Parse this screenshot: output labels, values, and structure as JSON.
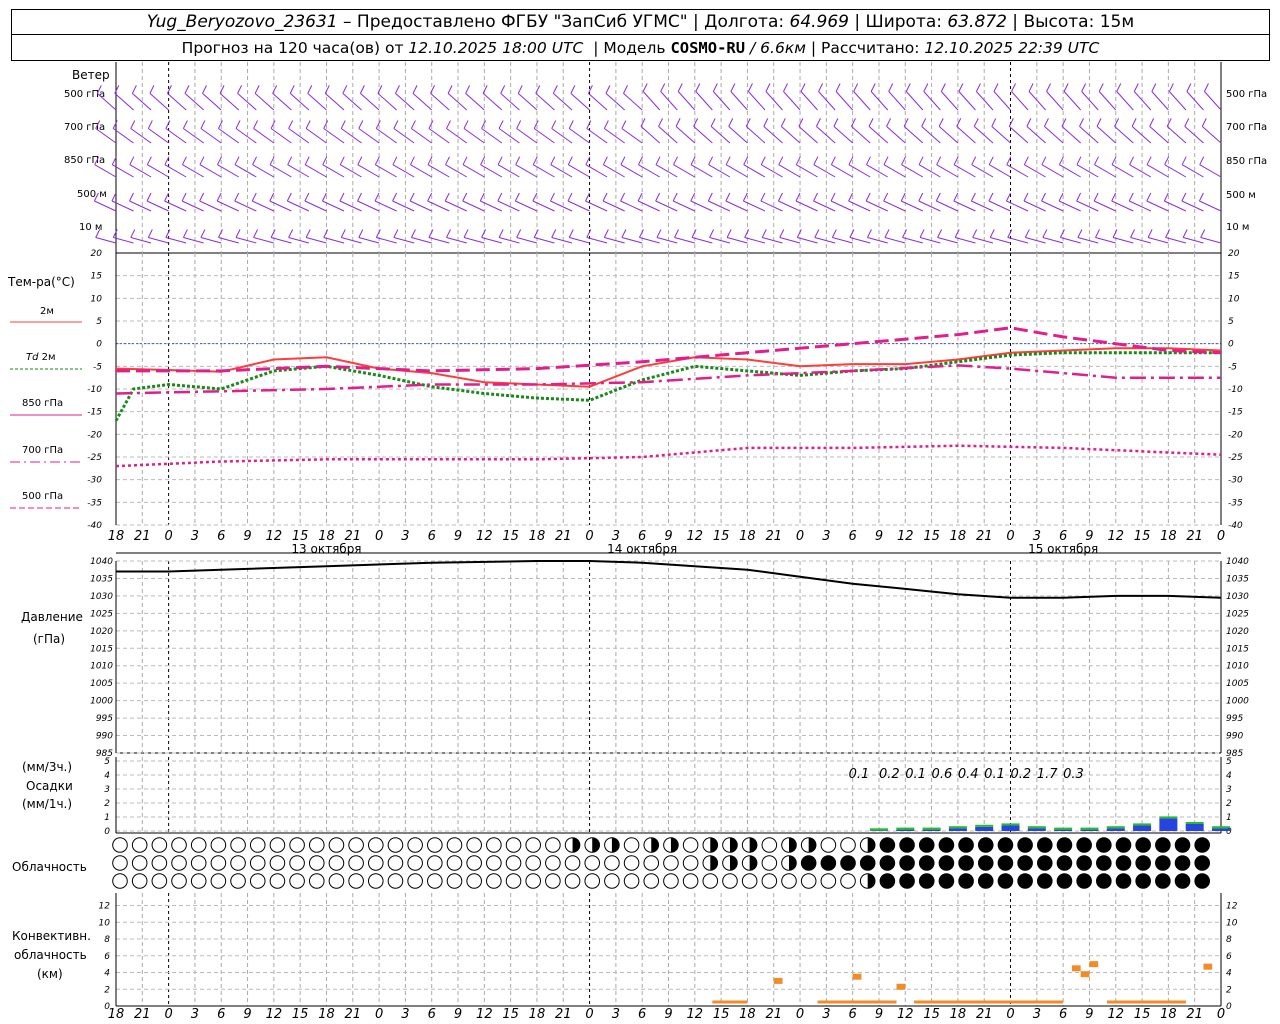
{
  "header": {
    "station": "Yug_Beryozovo_23631",
    "provider": "– Предоставлено ФГБУ \"ЗапСиб УГМС\"",
    "lon_label": "Долгота:",
    "lon": "64.969",
    "lat_label": "Широта:",
    "lat": "63.872",
    "alt_label": "Высота:",
    "alt": "15м",
    "fc_prefix": "Прогноз на 120 часа(ов) от",
    "fc_time": "12.10.2025 18:00 UTC",
    "model_prefix": "| Модель",
    "model": "COSMO-RU",
    "model_res": "/ 6.6км",
    "calc_prefix": "| Рассчитано:",
    "calc_time": "12.10.2025 22:39 UTC"
  },
  "labels": {
    "wind": "Ветер",
    "levels": [
      "500 гПа",
      "700 гПа",
      "850 гПа",
      "500 м",
      "10 м"
    ],
    "temp": "Тем-ра(°С)",
    "t2m": "2м",
    "td": "Td",
    "td2m": "2м",
    "t850": "850 гПа",
    "t700": "700 гПа",
    "t500": "500 гПа",
    "pres1": "Давление",
    "pres2": "(гПа)",
    "precip1": "(мм/3ч.)",
    "precip2": "Осадки",
    "precip3": "(мм/1ч.)",
    "cloud": "Облачность",
    "conv1": "Конвективн.",
    "conv2": "облачность",
    "conv3": "(км)"
  },
  "dates": [
    "13 октября",
    "14 октября",
    "15 октября"
  ],
  "colors": {
    "t2m": "#ff3c3c",
    "td": "#178a17",
    "levels": "#e01e8c",
    "wind": "#8a2be2",
    "pressure": "#000000",
    "conv": "#f28c28",
    "rain_green": "#22c022",
    "rain_blue": "#2844e0",
    "zero": "#3a5bd9"
  },
  "chart_data": [
    {
      "type": "line",
      "title": "Ветер",
      "x_hours": [
        18,
        21,
        0,
        3,
        6,
        9,
        12,
        15,
        18,
        21,
        0,
        3,
        6,
        9,
        12,
        15,
        18,
        21,
        0,
        3,
        6,
        9,
        12,
        15,
        18,
        21,
        0,
        3,
        6,
        9,
        12,
        15,
        18,
        21,
        0,
        3,
        6,
        9,
        12,
        15,
        18,
        21,
        0
      ],
      "series": [
        {
          "name": "500 гПа",
          "dir": 300
        },
        {
          "name": "700 гПа",
          "dir": 290
        },
        {
          "name": "850 гПа",
          "dir": 280
        },
        {
          "name": "500 м",
          "dir": 270
        },
        {
          "name": "10 м",
          "dir": 250
        }
      ]
    },
    {
      "type": "line",
      "title": "Тем-ра(°С)",
      "ylim": [
        -40,
        20
      ],
      "x_range_hours": [
        0,
        126
      ],
      "series": [
        {
          "name": "2м",
          "x": [
            0,
            6,
            12,
            18,
            24,
            30,
            36,
            42,
            48,
            54,
            60,
            66,
            72,
            78,
            84,
            90,
            96,
            102,
            108,
            114,
            120,
            126
          ],
          "values": [
            -5.5,
            -5.8,
            -6.2,
            -3.5,
            -3,
            -5.5,
            -6.5,
            -8.5,
            -9,
            -9.5,
            -5,
            -3,
            -3.5,
            -5,
            -4.5,
            -4.5,
            -3.5,
            -2,
            -1.5,
            -1,
            -1,
            -1.5
          ]
        },
        {
          "name": "Td 2м",
          "x": [
            0,
            2,
            6,
            12,
            18,
            24,
            30,
            36,
            42,
            48,
            54,
            60,
            66,
            72,
            78,
            84,
            90,
            96,
            102,
            108,
            114,
            120,
            126
          ],
          "values": [
            -17,
            -10,
            -9,
            -10,
            -6,
            -5,
            -7,
            -9.5,
            -11,
            -12,
            -12.5,
            -8,
            -5,
            -6,
            -7,
            -6,
            -5.5,
            -4,
            -2.5,
            -2,
            -2,
            -2,
            -2
          ]
        },
        {
          "name": "850 гПа",
          "x": [
            0,
            12,
            24,
            36,
            48,
            60,
            72,
            84,
            96,
            102,
            108,
            114,
            120,
            126
          ],
          "values": [
            -6,
            -6,
            -5,
            -6,
            -5.5,
            -4,
            -2,
            0,
            2,
            3.5,
            1.5,
            0,
            -1.5,
            -2
          ]
        },
        {
          "name": "700 гПа",
          "x": [
            0,
            12,
            24,
            36,
            48,
            60,
            72,
            84,
            96,
            102,
            108,
            114,
            120,
            126
          ],
          "values": [
            -11,
            -10.5,
            -10,
            -9,
            -9,
            -8.5,
            -7,
            -6,
            -4.8,
            -5.5,
            -6.5,
            -7.5,
            -7.5,
            -7.5
          ]
        },
        {
          "name": "500 гПа",
          "x": [
            0,
            12,
            24,
            36,
            48,
            60,
            72,
            84,
            96,
            108,
            114,
            120,
            126
          ],
          "values": [
            -27,
            -26,
            -25.5,
            -25.5,
            -25.5,
            -25,
            -23,
            -23,
            -22.5,
            -23,
            -23.5,
            -24,
            -24.5
          ]
        }
      ]
    },
    {
      "type": "line",
      "title": "Давление (гПа)",
      "ylim": [
        985,
        1040
      ],
      "series": [
        {
          "name": "pressure",
          "x": [
            0,
            6,
            12,
            24,
            36,
            48,
            54,
            60,
            66,
            72,
            78,
            84,
            90,
            96,
            102,
            108,
            114,
            120,
            126
          ],
          "values": [
            1037,
            1037,
            1037.5,
            1038.5,
            1039.5,
            1040,
            1040,
            1039.5,
            1038.5,
            1037.5,
            1035.5,
            1033.5,
            1032,
            1030.5,
            1029.5,
            1029.5,
            1030,
            1030,
            1029.5
          ]
        }
      ]
    },
    {
      "type": "bar",
      "title": "Осадки",
      "ylim": [
        0,
        5
      ],
      "labels_mm3h": [
        "0.1",
        "0.2",
        "0.1",
        "0.6",
        "0.4",
        "0.1",
        "0.2",
        "1.7",
        "0.3"
      ],
      "series": [
        {
          "name": "осадки",
          "x": [
            87,
            90,
            93,
            96,
            99,
            102,
            105,
            108,
            111,
            114,
            117,
            120,
            123,
            126
          ],
          "values": [
            0.05,
            0.1,
            0.1,
            0.2,
            0.3,
            0.4,
            0.2,
            0.1,
            0.1,
            0.2,
            0.4,
            0.9,
            0.5,
            0.2
          ]
        }
      ]
    },
    {
      "type": "table",
      "title": "Облачность",
      "rows": [
        {
          "start_partial": 48,
          "full_from": 86
        },
        {
          "start_partial": 66,
          "full_from": 78
        },
        {
          "start_partial": 84,
          "full_from": 86
        }
      ]
    },
    {
      "type": "bar",
      "title": "Конвективн. облачность (км)",
      "ylim": [
        0,
        13
      ],
      "series": [
        {
          "name": "конв",
          "bars": [
            [
              68,
              72,
              0.3
            ],
            [
              75,
              76,
              3
            ],
            [
              80,
              88,
              0.3
            ],
            [
              84,
              85,
              3.5
            ],
            [
              86,
              89,
              0.3
            ],
            [
              89,
              90,
              2.3
            ],
            [
              91,
              108,
              0.3
            ],
            [
              109,
              110,
              4.5
            ],
            [
              110,
              111,
              3.8
            ],
            [
              111,
              112,
              5
            ],
            [
              113,
              122,
              0.3
            ],
            [
              124,
              125,
              4.7
            ]
          ]
        }
      ]
    }
  ],
  "ticks": {
    "hours": [
      "18",
      "21",
      "0",
      "3",
      "6",
      "9",
      "12",
      "15",
      "18",
      "21",
      "0",
      "3",
      "6",
      "9",
      "12",
      "15",
      "18",
      "21",
      "0",
      "3",
      "6",
      "9",
      "12",
      "15",
      "18",
      "21",
      "0",
      "3",
      "6",
      "9",
      "12",
      "15",
      "18",
      "21",
      "0",
      "3",
      "6",
      "9",
      "12",
      "15",
      "18",
      "21",
      "0"
    ],
    "temp": [
      "20",
      "15",
      "10",
      "5",
      "0",
      "-5",
      "-10",
      "-15",
      "-20",
      "-25",
      "-30",
      "-35",
      "-40"
    ],
    "pres": [
      "1040",
      "1035",
      "1030",
      "1025",
      "1020",
      "1015",
      "1010",
      "1005",
      "1000",
      "995",
      "990",
      "985"
    ],
    "precip": [
      "5",
      "4",
      "3",
      "2",
      "1",
      "0"
    ],
    "conv": [
      "12",
      "10",
      "8",
      "6",
      "4",
      "2",
      "0"
    ]
  }
}
